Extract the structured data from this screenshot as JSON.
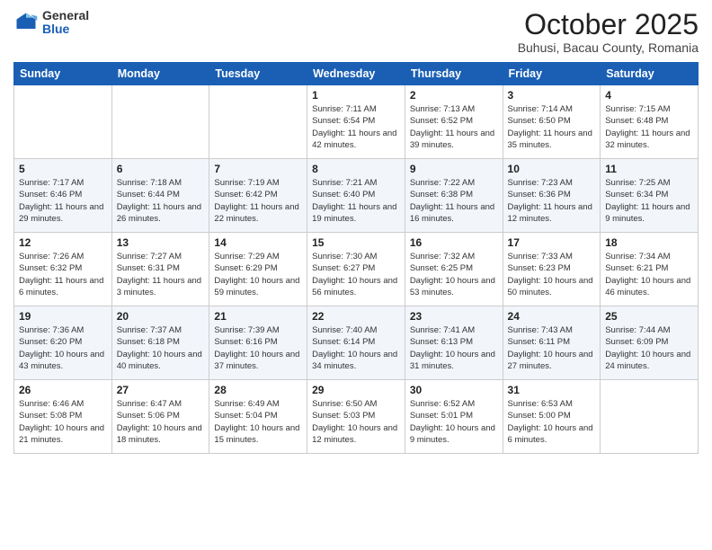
{
  "header": {
    "logo_general": "General",
    "logo_blue": "Blue",
    "month": "October 2025",
    "location": "Buhusi, Bacau County, Romania"
  },
  "days_of_week": [
    "Sunday",
    "Monday",
    "Tuesday",
    "Wednesday",
    "Thursday",
    "Friday",
    "Saturday"
  ],
  "weeks": [
    [
      {
        "day": "",
        "info": ""
      },
      {
        "day": "",
        "info": ""
      },
      {
        "day": "",
        "info": ""
      },
      {
        "day": "1",
        "info": "Sunrise: 7:11 AM\nSunset: 6:54 PM\nDaylight: 11 hours and 42 minutes."
      },
      {
        "day": "2",
        "info": "Sunrise: 7:13 AM\nSunset: 6:52 PM\nDaylight: 11 hours and 39 minutes."
      },
      {
        "day": "3",
        "info": "Sunrise: 7:14 AM\nSunset: 6:50 PM\nDaylight: 11 hours and 35 minutes."
      },
      {
        "day": "4",
        "info": "Sunrise: 7:15 AM\nSunset: 6:48 PM\nDaylight: 11 hours and 32 minutes."
      }
    ],
    [
      {
        "day": "5",
        "info": "Sunrise: 7:17 AM\nSunset: 6:46 PM\nDaylight: 11 hours and 29 minutes."
      },
      {
        "day": "6",
        "info": "Sunrise: 7:18 AM\nSunset: 6:44 PM\nDaylight: 11 hours and 26 minutes."
      },
      {
        "day": "7",
        "info": "Sunrise: 7:19 AM\nSunset: 6:42 PM\nDaylight: 11 hours and 22 minutes."
      },
      {
        "day": "8",
        "info": "Sunrise: 7:21 AM\nSunset: 6:40 PM\nDaylight: 11 hours and 19 minutes."
      },
      {
        "day": "9",
        "info": "Sunrise: 7:22 AM\nSunset: 6:38 PM\nDaylight: 11 hours and 16 minutes."
      },
      {
        "day": "10",
        "info": "Sunrise: 7:23 AM\nSunset: 6:36 PM\nDaylight: 11 hours and 12 minutes."
      },
      {
        "day": "11",
        "info": "Sunrise: 7:25 AM\nSunset: 6:34 PM\nDaylight: 11 hours and 9 minutes."
      }
    ],
    [
      {
        "day": "12",
        "info": "Sunrise: 7:26 AM\nSunset: 6:32 PM\nDaylight: 11 hours and 6 minutes."
      },
      {
        "day": "13",
        "info": "Sunrise: 7:27 AM\nSunset: 6:31 PM\nDaylight: 11 hours and 3 minutes."
      },
      {
        "day": "14",
        "info": "Sunrise: 7:29 AM\nSunset: 6:29 PM\nDaylight: 10 hours and 59 minutes."
      },
      {
        "day": "15",
        "info": "Sunrise: 7:30 AM\nSunset: 6:27 PM\nDaylight: 10 hours and 56 minutes."
      },
      {
        "day": "16",
        "info": "Sunrise: 7:32 AM\nSunset: 6:25 PM\nDaylight: 10 hours and 53 minutes."
      },
      {
        "day": "17",
        "info": "Sunrise: 7:33 AM\nSunset: 6:23 PM\nDaylight: 10 hours and 50 minutes."
      },
      {
        "day": "18",
        "info": "Sunrise: 7:34 AM\nSunset: 6:21 PM\nDaylight: 10 hours and 46 minutes."
      }
    ],
    [
      {
        "day": "19",
        "info": "Sunrise: 7:36 AM\nSunset: 6:20 PM\nDaylight: 10 hours and 43 minutes."
      },
      {
        "day": "20",
        "info": "Sunrise: 7:37 AM\nSunset: 6:18 PM\nDaylight: 10 hours and 40 minutes."
      },
      {
        "day": "21",
        "info": "Sunrise: 7:39 AM\nSunset: 6:16 PM\nDaylight: 10 hours and 37 minutes."
      },
      {
        "day": "22",
        "info": "Sunrise: 7:40 AM\nSunset: 6:14 PM\nDaylight: 10 hours and 34 minutes."
      },
      {
        "day": "23",
        "info": "Sunrise: 7:41 AM\nSunset: 6:13 PM\nDaylight: 10 hours and 31 minutes."
      },
      {
        "day": "24",
        "info": "Sunrise: 7:43 AM\nSunset: 6:11 PM\nDaylight: 10 hours and 27 minutes."
      },
      {
        "day": "25",
        "info": "Sunrise: 7:44 AM\nSunset: 6:09 PM\nDaylight: 10 hours and 24 minutes."
      }
    ],
    [
      {
        "day": "26",
        "info": "Sunrise: 6:46 AM\nSunset: 5:08 PM\nDaylight: 10 hours and 21 minutes."
      },
      {
        "day": "27",
        "info": "Sunrise: 6:47 AM\nSunset: 5:06 PM\nDaylight: 10 hours and 18 minutes."
      },
      {
        "day": "28",
        "info": "Sunrise: 6:49 AM\nSunset: 5:04 PM\nDaylight: 10 hours and 15 minutes."
      },
      {
        "day": "29",
        "info": "Sunrise: 6:50 AM\nSunset: 5:03 PM\nDaylight: 10 hours and 12 minutes."
      },
      {
        "day": "30",
        "info": "Sunrise: 6:52 AM\nSunset: 5:01 PM\nDaylight: 10 hours and 9 minutes."
      },
      {
        "day": "31",
        "info": "Sunrise: 6:53 AM\nSunset: 5:00 PM\nDaylight: 10 hours and 6 minutes."
      },
      {
        "day": "",
        "info": ""
      }
    ]
  ]
}
